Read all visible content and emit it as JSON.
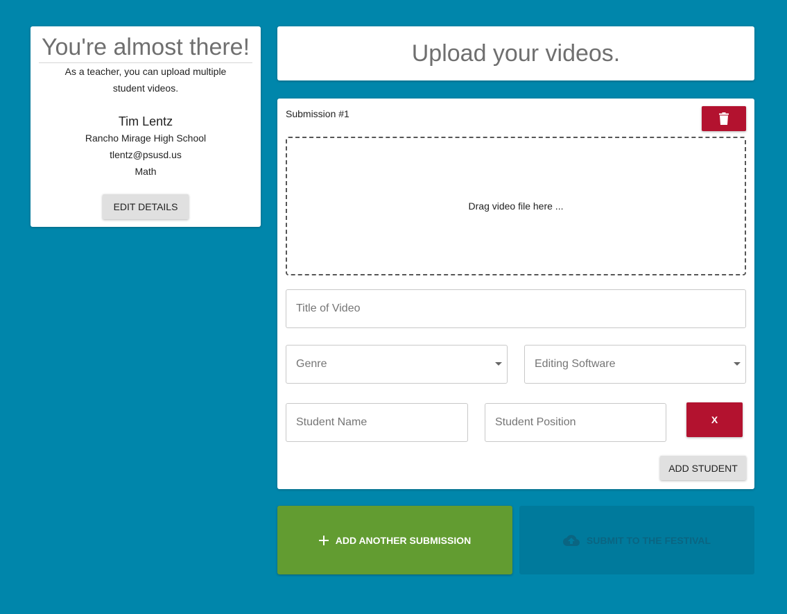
{
  "profile": {
    "heading": "You're almost there!",
    "intro": "As a teacher, you can upload multiple student videos.",
    "name": "Tim Lentz",
    "school": "Rancho Mirage High School",
    "email": "tlentz@psusd.us",
    "subject": "Math",
    "edit_label": "EDIT DETAILS"
  },
  "upload": {
    "title": "Upload your videos."
  },
  "submission": {
    "label": "Submission #1",
    "delete_icon": "trash-icon",
    "dropzone_text": "Drag video file here ...",
    "title_placeholder": "Title of Video",
    "genre_label": "Genre",
    "software_label": "Editing Software",
    "student_name_placeholder": "Student Name",
    "student_position_placeholder": "Student Position",
    "remove_student_label": "X",
    "add_student_label": "ADD STUDENT"
  },
  "actions": {
    "add_submission_label": "ADD ANOTHER SUBMISSION",
    "add_submission_icon": "plus-icon",
    "submit_label": "SUBMIT TO THE FESTIVAL",
    "submit_icon": "cloud-upload-icon"
  },
  "colors": {
    "background": "#0086ab",
    "danger": "#b3122f",
    "success": "#629c31",
    "disabled": "#007a9c"
  }
}
